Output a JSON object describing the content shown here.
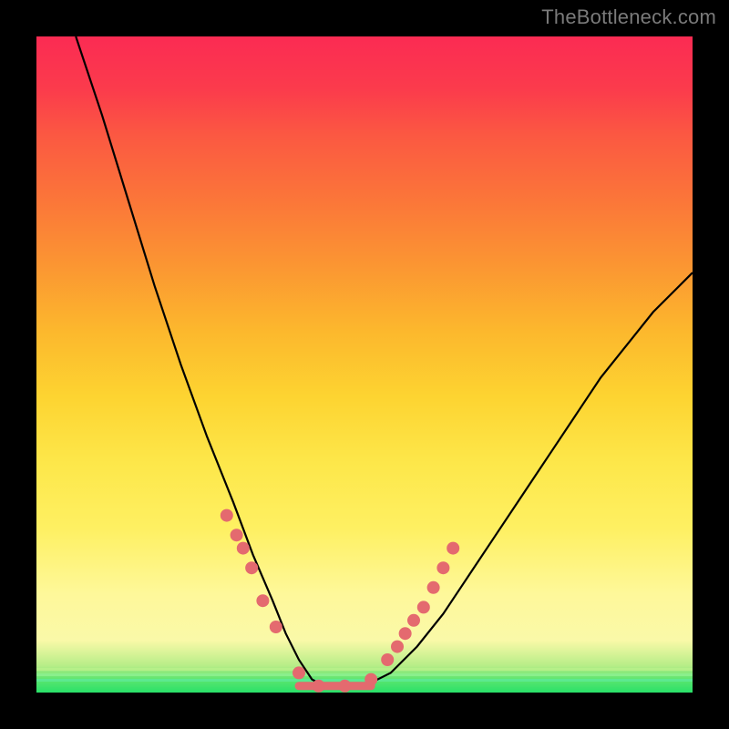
{
  "watermark": "TheBottleneck.com",
  "colors": {
    "dot": "#e46a6f",
    "curve": "#000000"
  },
  "chart_data": {
    "type": "line",
    "title": "",
    "xlabel": "",
    "ylabel": "",
    "xlim": [
      0,
      100
    ],
    "ylim": [
      0,
      100
    ],
    "series": [
      {
        "name": "bottleneck-curve",
        "x": [
          6,
          10,
          14,
          18,
          22,
          26,
          30,
          33,
          36,
          38,
          40,
          42,
          44,
          46,
          50,
          54,
          58,
          62,
          66,
          70,
          74,
          78,
          82,
          86,
          90,
          94,
          98,
          100
        ],
        "y": [
          100,
          88,
          75,
          62,
          50,
          39,
          29,
          21,
          14,
          9,
          5,
          2,
          1,
          1,
          1,
          3,
          7,
          12,
          18,
          24,
          30,
          36,
          42,
          48,
          53,
          58,
          62,
          64
        ]
      }
    ],
    "highlight_points": {
      "name": "marked-dots",
      "x": [
        29,
        30.5,
        31.5,
        32.8,
        34.5,
        36.5,
        40,
        43,
        47,
        51,
        53.5,
        55,
        56.2,
        57.5,
        59,
        60.5,
        62,
        63.5
      ],
      "y": [
        27,
        24,
        22,
        19,
        14,
        10,
        3,
        1,
        1,
        2,
        5,
        7,
        9,
        11,
        13,
        16,
        19,
        22
      ]
    },
    "flat_region": {
      "x_start": 40,
      "x_end": 51,
      "y": 1
    }
  }
}
